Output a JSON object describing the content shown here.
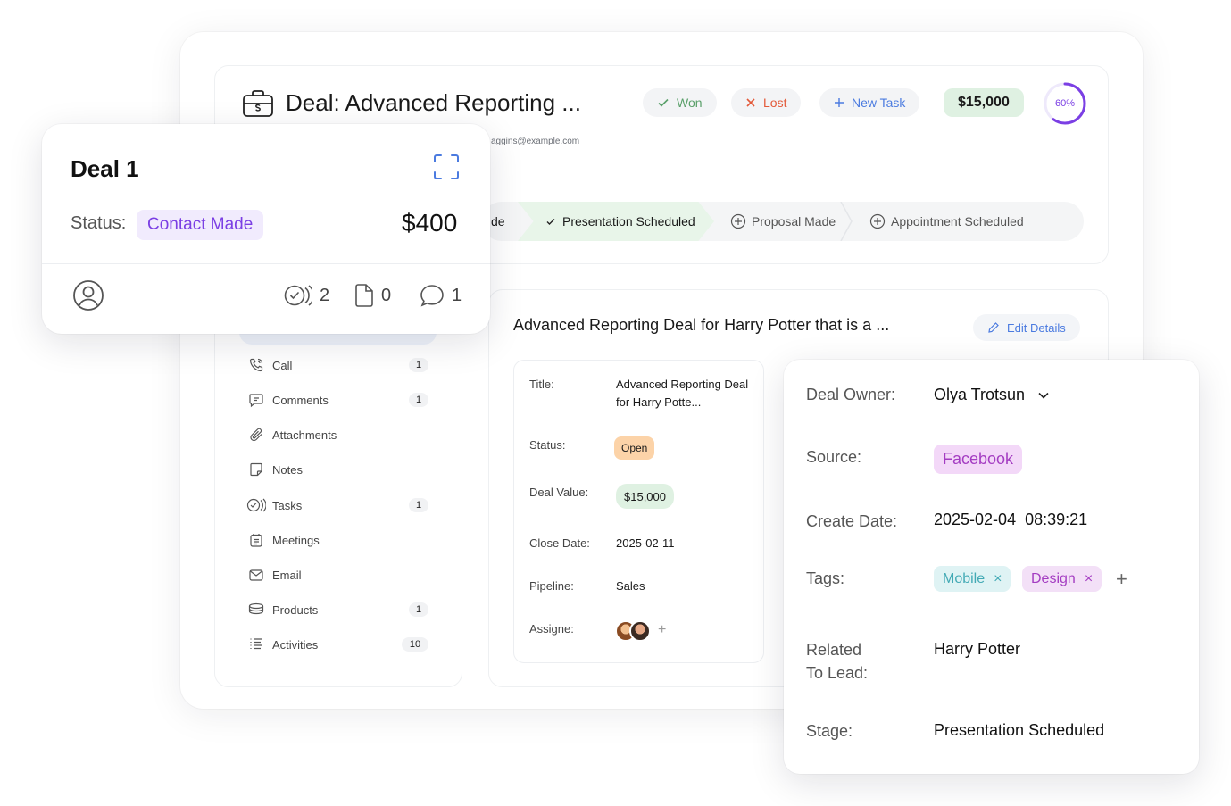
{
  "header": {
    "deal_title": "Deal: Advanced Reporting ...",
    "email_snippet": "aggins@example.com",
    "won_label": "Won",
    "lost_label": "Lost",
    "new_task_label": "New Task",
    "deal_value": "$15,000",
    "progress_label": "60%",
    "progress_value": 0.6,
    "stages": {
      "partial": "de",
      "active": "Presentation Scheduled",
      "proposal": "Proposal Made",
      "appointment": "Appointment Scheduled"
    }
  },
  "sidebar": {
    "items": [
      {
        "label": "Call",
        "count": "1",
        "icon": "phone-icon"
      },
      {
        "label": "Comments",
        "count": "1",
        "icon": "comment-icon"
      },
      {
        "label": "Attachments",
        "count": "",
        "icon": "paperclip-icon"
      },
      {
        "label": "Notes",
        "count": "",
        "icon": "note-icon"
      },
      {
        "label": "Tasks",
        "count": "1",
        "icon": "tasks-icon"
      },
      {
        "label": "Meetings",
        "count": "",
        "icon": "calendar-icon"
      },
      {
        "label": "Email",
        "count": "",
        "icon": "mail-icon"
      },
      {
        "label": "Products",
        "count": "1",
        "icon": "stack-icon"
      },
      {
        "label": "Activities",
        "count": "10",
        "icon": "list-icon"
      }
    ]
  },
  "content": {
    "title": "Advanced Reporting Deal for Harry Potter that is a ...",
    "edit_label": "Edit Details",
    "details": {
      "title_label": "Title:",
      "title_value": "Advanced Reporting Deal for Harry Potte...",
      "status_label": "Status:",
      "status_value": "Open",
      "value_label": "Deal Value:",
      "value_value": "$15,000",
      "close_label": "Close Date:",
      "close_value": "2025-02-11",
      "pipeline_label": "Pipeline:",
      "pipeline_value": "Sales",
      "assignee_label": "Assigne:",
      "add_symbol": "+"
    }
  },
  "deal_card": {
    "title": "Deal 1",
    "status_label": "Status:",
    "status_value": "Contact Made",
    "amount": "$400",
    "tasks_count": "2",
    "files_count": "0",
    "comments_count": "1"
  },
  "info_card": {
    "owner_label": "Deal Owner:",
    "owner_value": "Olya Trotsun",
    "source_label": "Source:",
    "source_value": "Facebook",
    "create_label": "Create Date:",
    "create_value": "2025-02-04  08:39:21",
    "tags_label": "Tags:",
    "tags": [
      "Mobile",
      "Design"
    ],
    "tag_remove": "×",
    "tag_add": "+",
    "related_label_1": "Related",
    "related_label_2": "To Lead:",
    "related_value": "Harry Potter",
    "stage_label": "Stage:",
    "stage_value": "Presentation Scheduled"
  },
  "colors": {
    "accent_purple": "#7b3fe4",
    "accent_blue": "#4b7be0",
    "won_green": "#5aa06a",
    "lost_red": "#e35a3a",
    "value_green_bg": "#dff1e2"
  }
}
